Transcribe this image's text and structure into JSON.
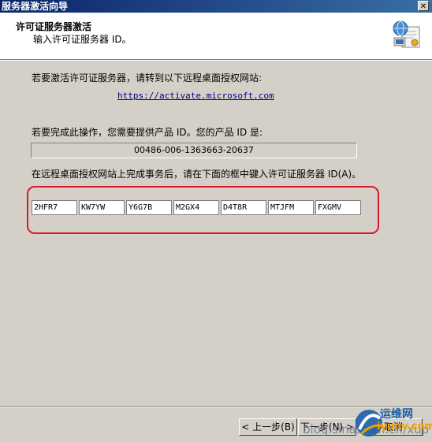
{
  "window": {
    "title": "服务器激活向导",
    "close_glyph": "✕"
  },
  "header": {
    "title": "许可证服务器激活",
    "subtitle": "输入许可证服务器 ID。",
    "icon": "certificate-wizard-icon"
  },
  "body": {
    "instruction_1": "若要激活许可证服务器，请转到以下远程桌面授权网站:",
    "url": "https://activate.microsoft.com",
    "instruction_2": "若要完成此操作，您需要提供产品 ID。您的产品 ID 是:",
    "product_id": "00486-006-1363663-20637",
    "instruction_3": "在远程桌面授权网站上完成事务后，请在下面的框中键入许可证服务器 ID(A)。",
    "server_id_fields": [
      "2HFR7",
      "KW7YW",
      "Y6G7B",
      "M2GX4",
      "D4T8R",
      "MTJFM",
      "FXGMV"
    ]
  },
  "footer": {
    "back_label": "< 上一步(B)",
    "next_label": "下一步(N) >",
    "cancel_label": "取消"
  },
  "watermark": {
    "text": "blog.sina.com.cn/xup",
    "logo_cn": "运维网",
    "logo_en": "iyunv.com"
  },
  "colors": {
    "highlight": "#d41c2c",
    "titlebar_start": "#0a246a",
    "dialog_bg": "#d4d0c8",
    "link": "#000080"
  }
}
